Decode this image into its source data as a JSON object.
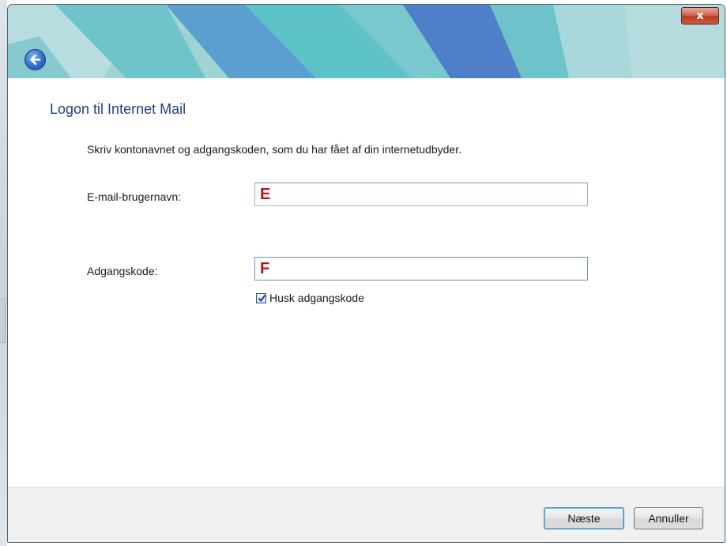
{
  "window": {
    "close_label": "x",
    "back_icon": "back-arrow-icon"
  },
  "heading": "Logon til Internet Mail",
  "instruction": "Skriv kontonavnet og adgangskoden, som du har fået af din internetudbyder.",
  "form": {
    "email_label": "E-mail-brugernavn:",
    "email_value": "E",
    "password_label": "Adgangskode:",
    "password_value": "F",
    "remember_label": "Husk adgangskode",
    "remember_checked": true
  },
  "buttons": {
    "next": "Næste",
    "cancel": "Annuller"
  },
  "colors": {
    "heading": "#1f3f85",
    "title_teal": "#5ec3c9",
    "title_blue": "#4f7fc9",
    "annotation_red": "#b3131a"
  }
}
